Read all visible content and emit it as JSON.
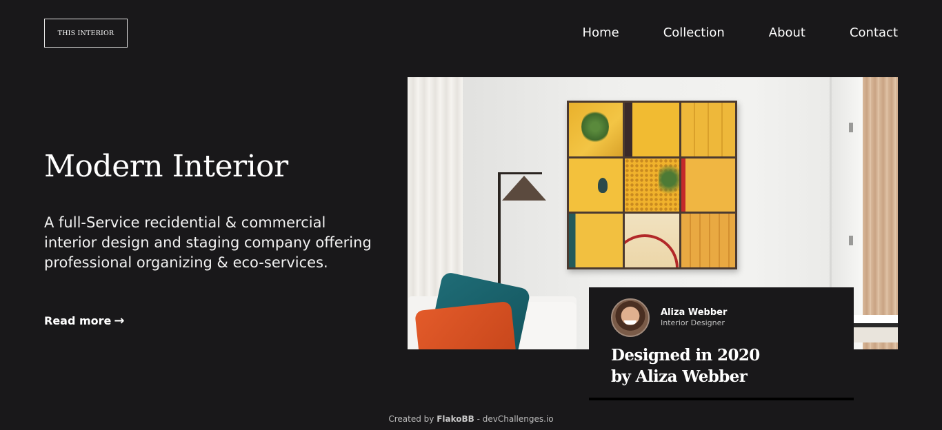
{
  "header": {
    "logo": "THIS INTERIOR",
    "nav": [
      {
        "label": "Home"
      },
      {
        "label": "Collection"
      },
      {
        "label": "About"
      },
      {
        "label": "Contact"
      }
    ]
  },
  "hero": {
    "title": "Modern Interior",
    "description": "A full-Service recidential & commercial interior design and staging company offering professional organizing & eco-services.",
    "read_more": "Read more",
    "read_more_icon": "arrow-right-icon"
  },
  "card": {
    "designer_name": "Aliza Webber",
    "designer_role": "Interior Designer",
    "title_line1": "Designed in 2020",
    "title_line2": "by Aliza Webber"
  },
  "footer": {
    "prefix": "Created by ",
    "author": "FlakoBB",
    "suffix": " - devChallenges.io"
  },
  "colors": {
    "background": "#19181a",
    "text": "#ffffff",
    "muted": "#bdbdbd"
  }
}
